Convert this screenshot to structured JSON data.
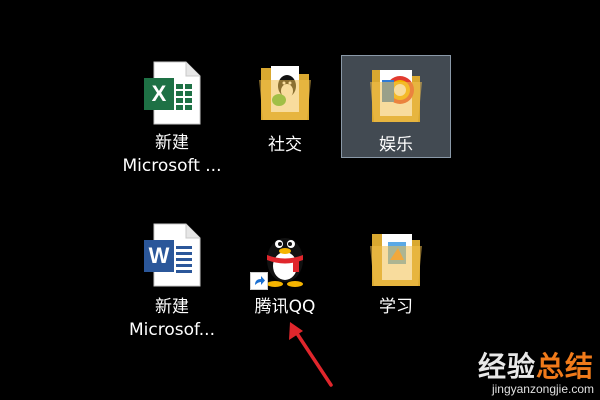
{
  "desktop": {
    "icons": [
      {
        "label": "新建\nMicrosoft ...",
        "icon": "excel-document-icon",
        "type": "file"
      },
      {
        "label": "社交",
        "icon": "folder-icon",
        "type": "folder"
      },
      {
        "label": "娱乐",
        "icon": "folder-icon",
        "type": "folder",
        "selected": true
      },
      {
        "label": "新建\nMicrosof...",
        "icon": "word-document-icon",
        "type": "file"
      },
      {
        "label": "腾讯QQ",
        "icon": "qq-penguin-icon",
        "type": "shortcut"
      },
      {
        "label": "学习",
        "icon": "folder-icon",
        "type": "folder"
      }
    ]
  },
  "annotation": {
    "icon": "red-arrow-icon",
    "color": "#e0262c"
  },
  "watermark": {
    "main_part1": "经验",
    "main_part2": "总结",
    "sub": "jingyanzongjie.com"
  },
  "colors": {
    "background": "#000000",
    "selection": "#6f7d8c",
    "excel_green": "#1e7145",
    "word_blue": "#2b579a",
    "folder_yellow": "#f2c04d"
  }
}
